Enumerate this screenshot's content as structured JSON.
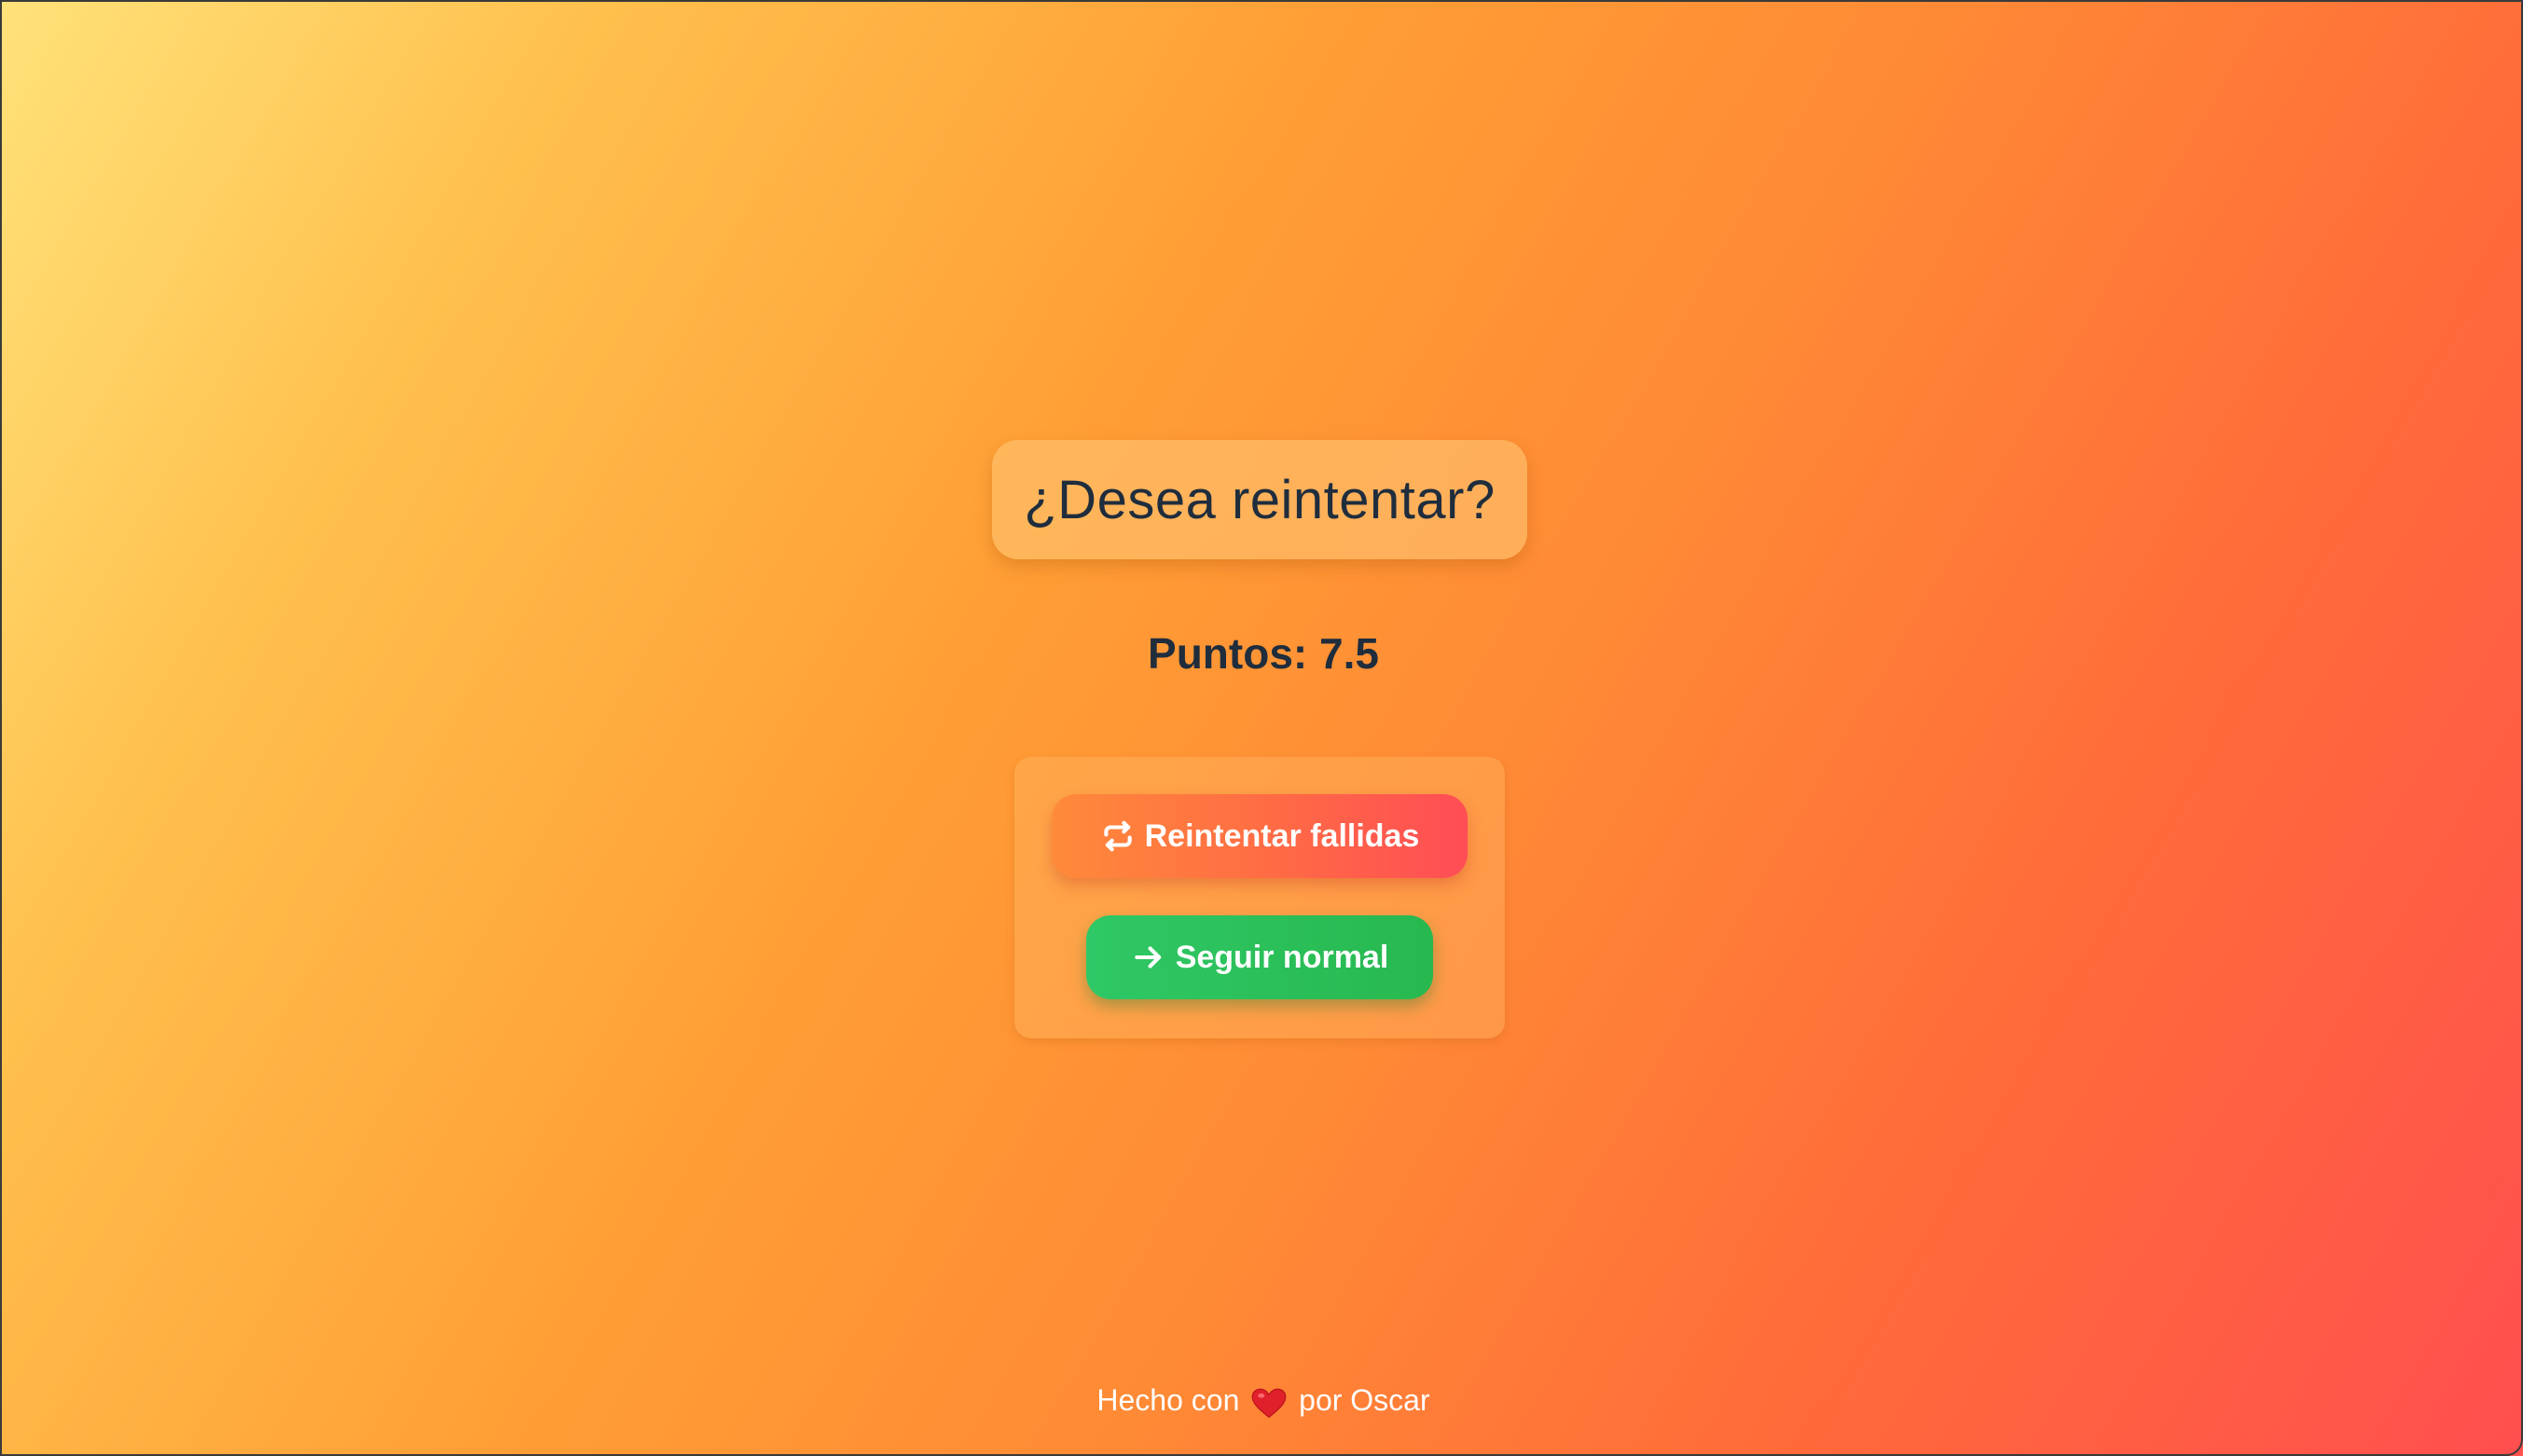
{
  "dialog": {
    "title": "¿Desea reintentar?",
    "score": "Puntos: 7.5"
  },
  "actions": {
    "retry_label": "Reintentar fallidas",
    "retry_icon": "retry-arrows-icon",
    "continue_label": "Seguir normal",
    "continue_icon": "arrow-right-icon"
  },
  "footer": {
    "made_with": "Hecho con",
    "heart_icon": "heart-icon",
    "by_author": "por Oscar"
  },
  "colors": {
    "text_dark": "#1f2d3d",
    "retry_button": "#ff6a45",
    "continue_button": "#2bbf5a",
    "heart": "#e0202a"
  }
}
